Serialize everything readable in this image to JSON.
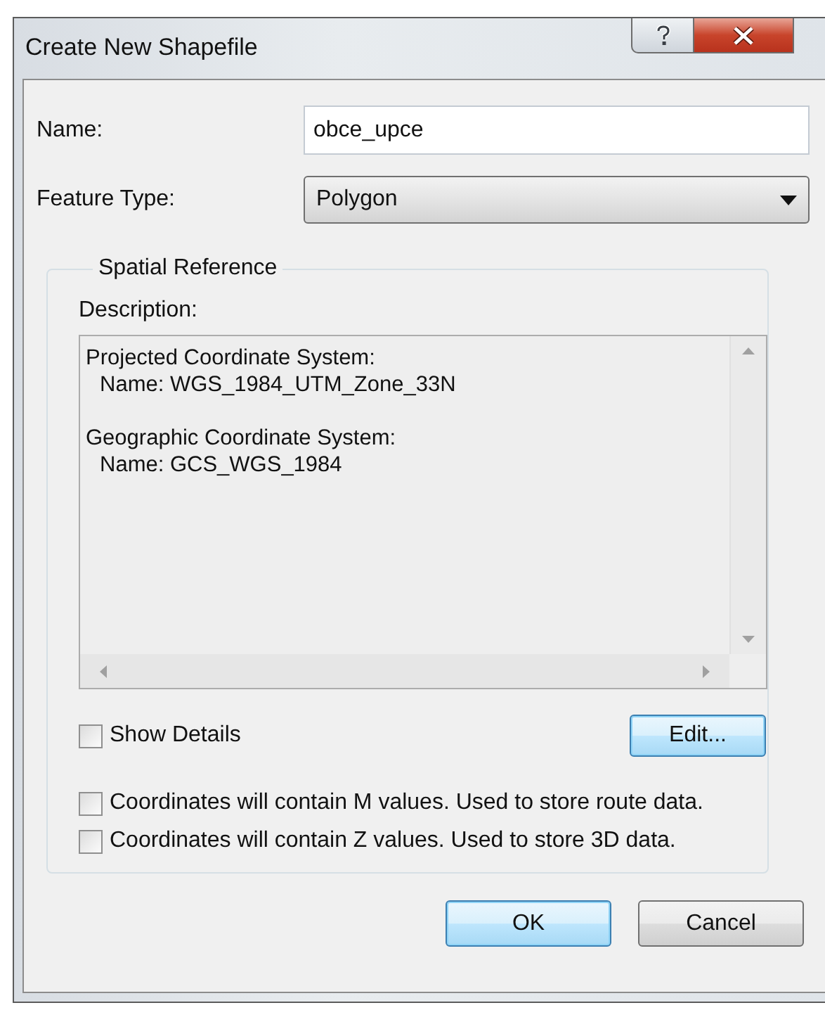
{
  "window": {
    "title": "Create New Shapefile"
  },
  "name_field": {
    "label": "Name:",
    "value": "obce_upce"
  },
  "feature_type": {
    "label": "Feature Type:",
    "value": "Polygon"
  },
  "spatial_reference": {
    "title": "Spatial Reference",
    "description_label": "Description:",
    "description": [
      {
        "heading": "Projected Coordinate System:",
        "entry": "Name: WGS_1984_UTM_Zone_33N"
      },
      {
        "heading": "Geographic Coordinate System:",
        "entry": "Name: GCS_WGS_1984"
      }
    ],
    "show_details": {
      "label": "Show Details",
      "checked": false
    },
    "edit_button": {
      "label": "Edit...",
      "focused": true
    },
    "options": [
      {
        "label": "Coordinates will contain M values. Used to store route data.",
        "checked": false
      },
      {
        "label": "Coordinates will contain Z values. Used to store 3D data.",
        "checked": false
      }
    ]
  },
  "buttons": [
    {
      "label": "OK",
      "focused": true
    },
    {
      "label": "Cancel",
      "focused": false
    }
  ]
}
